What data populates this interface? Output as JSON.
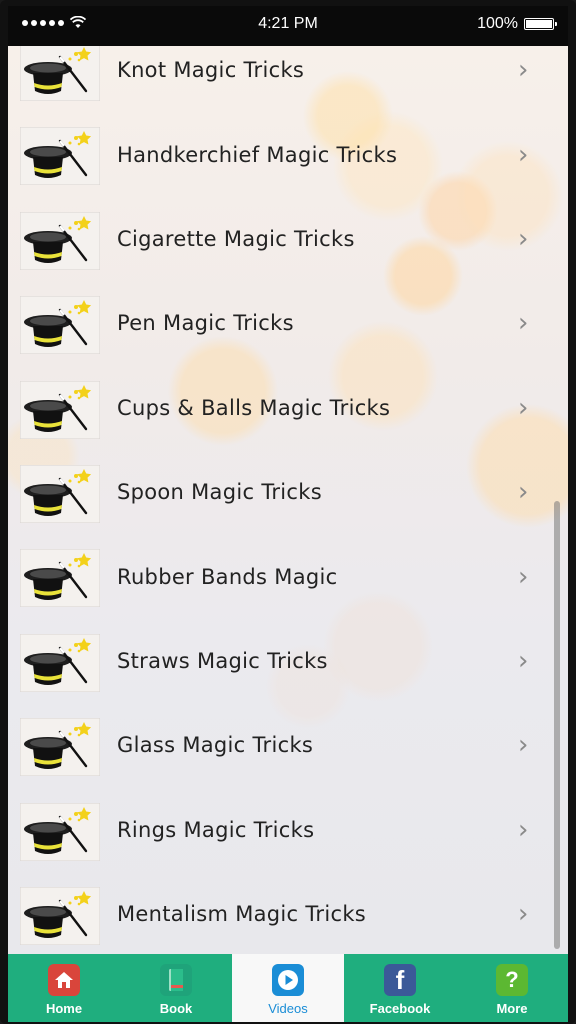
{
  "status_bar": {
    "time": "4:21 PM",
    "battery": "100%",
    "battery_level": 1.0
  },
  "list": {
    "items": [
      {
        "label": "Knot Magic Tricks"
      },
      {
        "label": "Handkerchief Magic Tricks"
      },
      {
        "label": "Cigarette Magic Tricks"
      },
      {
        "label": "Pen Magic Tricks"
      },
      {
        "label": "Cups & Balls Magic Tricks"
      },
      {
        "label": "Spoon Magic Tricks"
      },
      {
        "label": "Rubber Bands Magic"
      },
      {
        "label": "Straws Magic Tricks"
      },
      {
        "label": "Glass Magic Tricks"
      },
      {
        "label": "Rings Magic Tricks"
      },
      {
        "label": "Mentalism Magic Tricks"
      }
    ],
    "thumbnail_icon": "magic-hat-wand-icon",
    "chevron": "›"
  },
  "tab_bar": {
    "tabs": [
      {
        "label": "Home",
        "icon": "home-icon",
        "color": "#d9453b",
        "active": false
      },
      {
        "label": "Book",
        "icon": "book-icon",
        "color": "#1fa37a",
        "active": false
      },
      {
        "label": "Videos",
        "icon": "play-icon",
        "color": "#1a8dd6",
        "active": true
      },
      {
        "label": "Facebook",
        "icon": "facebook-icon",
        "color": "#3b5998",
        "active": false
      },
      {
        "label": "More",
        "icon": "question-icon",
        "color": "#5cb832",
        "active": false
      }
    ],
    "background": "#1fae7e"
  }
}
